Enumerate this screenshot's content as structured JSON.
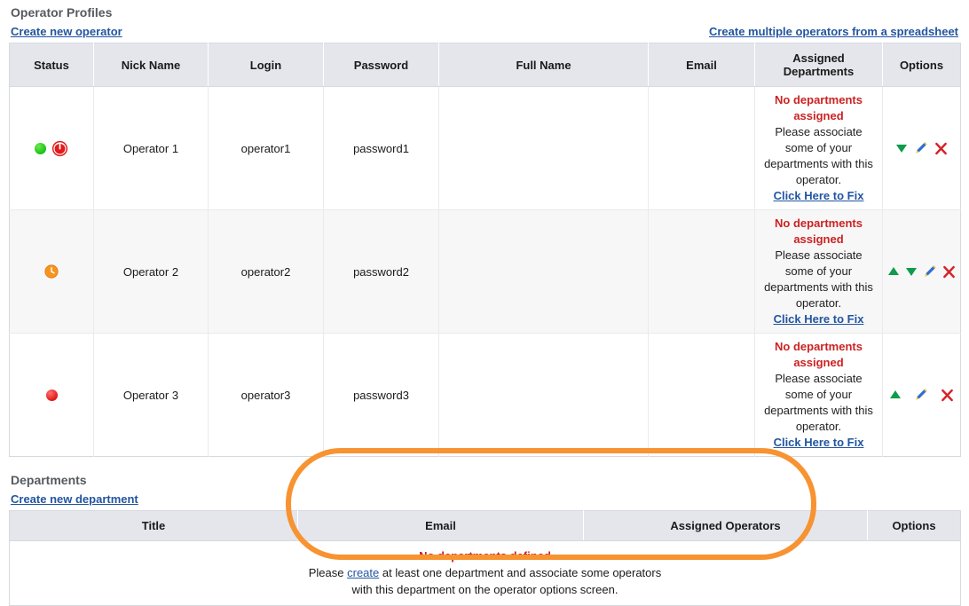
{
  "operators_section": {
    "title": "Operator Profiles",
    "create_link": "Create new operator",
    "bulk_link": "Create multiple operators from a spreadsheet",
    "columns": [
      "Status",
      "Nick Name",
      "Login",
      "Password",
      "Full Name",
      "Email",
      "Assigned Departments",
      "Options"
    ],
    "no_dept_warning": "No departments assigned",
    "no_dept_body": "Please associate some of your departments with this operator.",
    "fix_link": "Click Here to Fix",
    "rows": [
      {
        "status_icons": [
          "online-dot",
          "power-off-button"
        ],
        "nick_name": "Operator 1",
        "login": "operator1",
        "password": "password1",
        "full_name": "",
        "email": "",
        "options": [
          "move-down-icon",
          "edit-icon",
          "delete-icon"
        ]
      },
      {
        "status_icons": [
          "away-clock"
        ],
        "nick_name": "Operator 2",
        "login": "operator2",
        "password": "password2",
        "full_name": "",
        "email": "",
        "options": [
          "move-up-icon",
          "move-down-icon",
          "edit-icon",
          "delete-icon"
        ]
      },
      {
        "status_icons": [
          "offline-dot"
        ],
        "nick_name": "Operator 3",
        "login": "operator3",
        "password": "password3",
        "full_name": "",
        "email": "",
        "options": [
          "move-up-icon",
          "edit-icon",
          "delete-icon"
        ]
      }
    ]
  },
  "departments_section": {
    "title": "Departments",
    "create_link": "Create new department",
    "columns": [
      "Title",
      "Email",
      "Assigned Operators",
      "Options"
    ],
    "empty_warning": "No departments defined",
    "empty_line1_pre": "Please ",
    "empty_line1_link": "create",
    "empty_line1_post": " at least one department and associate some operators",
    "empty_line2": "with this department on the operator options screen."
  },
  "annotation": {
    "shape": "orange-ellipse-highlight",
    "color": "#f79331"
  },
  "colors": {
    "header_bg": "#e4e6ec",
    "link": "#2255a0",
    "warning": "#cc2222",
    "stripe": "#f7f7f8",
    "annotation": "#f79331"
  }
}
